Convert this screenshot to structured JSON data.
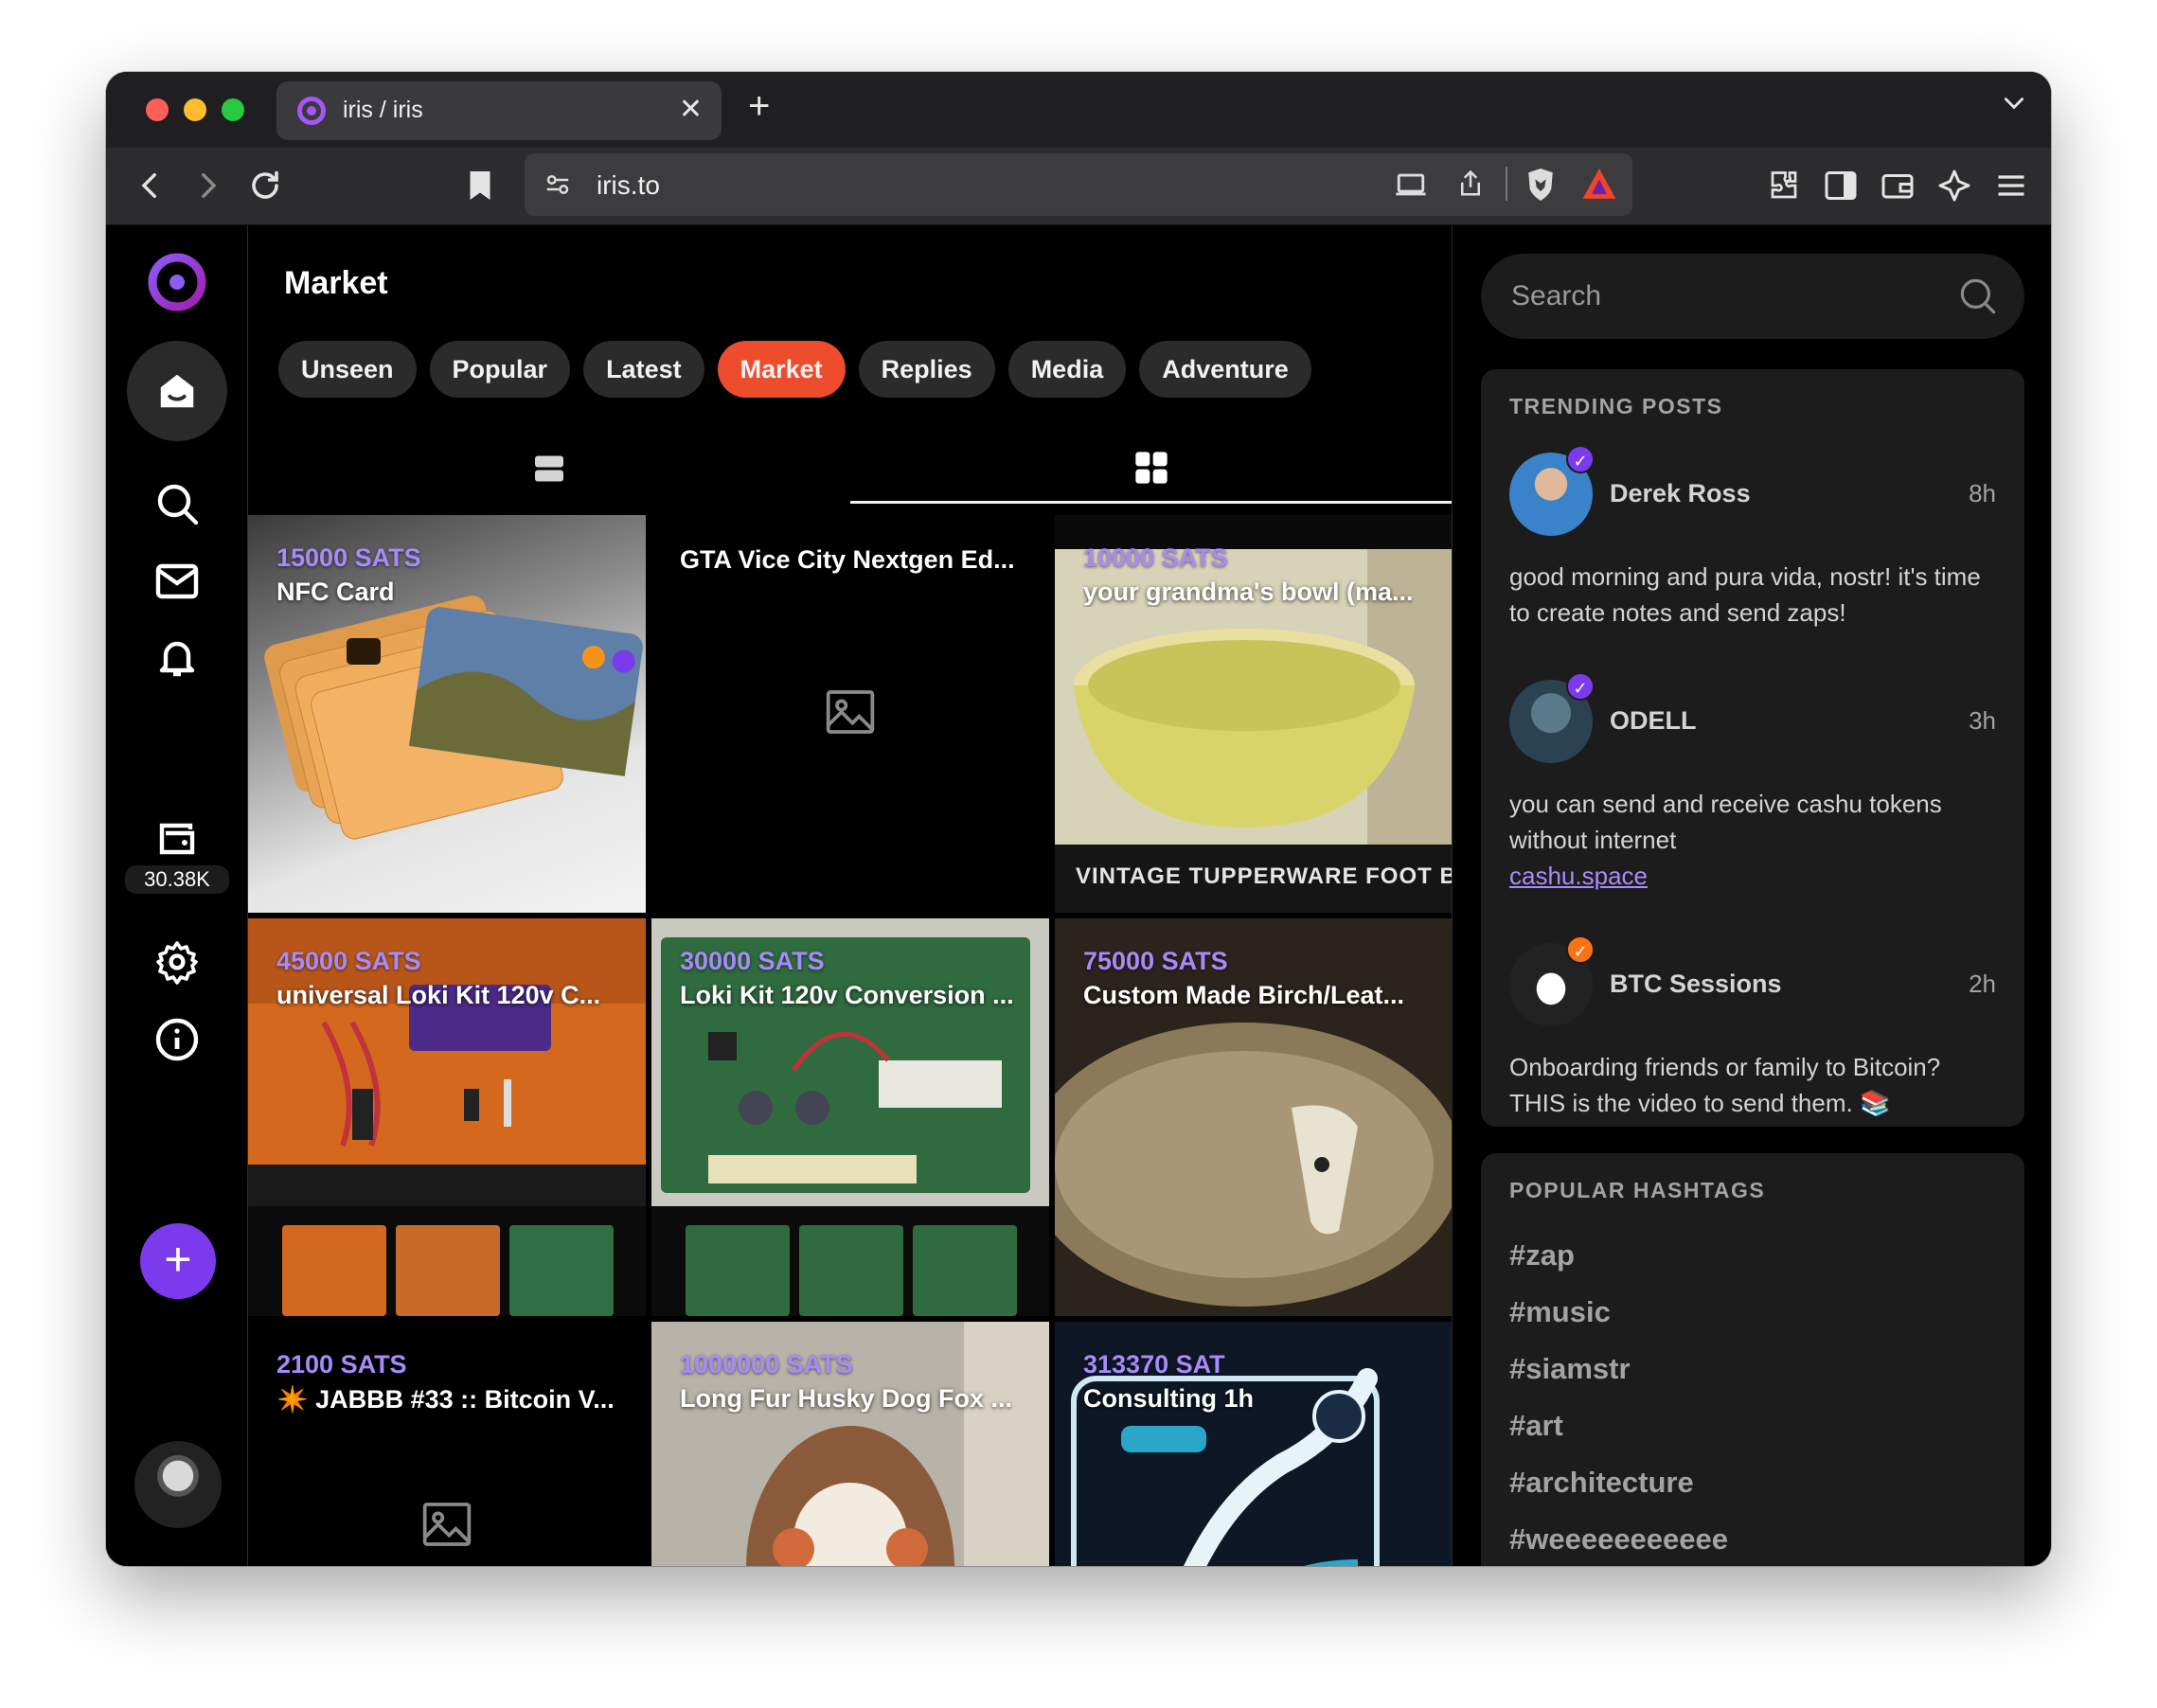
{
  "browser": {
    "tab_title": "iris / iris",
    "tab_close": "✕",
    "new_tab": "+",
    "tab_menu": "⌄",
    "url": "iris.to"
  },
  "leftnav": {
    "wallet_balance": "30.38K",
    "compose_label": "+"
  },
  "main": {
    "title": "Market",
    "feeds": [
      {
        "label": "Unseen",
        "active": false
      },
      {
        "label": "Popular",
        "active": false
      },
      {
        "label": "Latest",
        "active": false
      },
      {
        "label": "Market",
        "active": true
      },
      {
        "label": "Replies",
        "active": false
      },
      {
        "label": "Media",
        "active": false
      },
      {
        "label": "Adventure",
        "active": false
      }
    ],
    "listings": [
      {
        "price": "15000 SATS",
        "title": "NFC Card"
      },
      {
        "price": "",
        "title": "GTA Vice City Nextgen Ed..."
      },
      {
        "price": "10000 SATS",
        "title": "your grandma's bowl (ma..."
      },
      {
        "price": "45000 SATS",
        "title": "universal Loki Kit 120v C..."
      },
      {
        "price": "30000 SATS",
        "title": "Loki Kit 120v Conversion ..."
      },
      {
        "price": "75000 SATS",
        "title": "Custom Made Birch/Leat..."
      },
      {
        "price": "2100 SATS",
        "title": "✴️ JABBB #33 :: Bitcoin V..."
      },
      {
        "price": "1000000 SATS",
        "title": "Long Fur Husky Dog Fox ..."
      },
      {
        "price": "313370 SAT",
        "title": "Consulting 1h"
      }
    ],
    "bowl_caption": "VINTAGE TUPPERWARE FOOT BATH/"
  },
  "sidebar": {
    "search_placeholder": "Search",
    "trending_heading": "TRENDING POSTS",
    "posts": [
      {
        "name": "Derek Ross",
        "time": "8h",
        "text": "good morning and pura vida, nostr! it's time to create notes and send zaps!",
        "link": "",
        "badge_color": "#7c3aed"
      },
      {
        "name": "ODELL",
        "time": "3h",
        "text": "you can send and receive cashu tokens without internet",
        "link": "cashu.space",
        "badge_color": "#7c3aed"
      },
      {
        "name": "BTC Sessions",
        "time": "2h",
        "text": "Onboarding friends or family to Bitcoin? THIS is the video to send them. 📚",
        "link": "",
        "badge_color": "#f97316"
      }
    ],
    "hashtags_heading": "POPULAR HASHTAGS",
    "hashtags": [
      "#zap",
      "#music",
      "#siamstr",
      "#art",
      "#architecture",
      "#weeeeeeeeeee"
    ]
  }
}
